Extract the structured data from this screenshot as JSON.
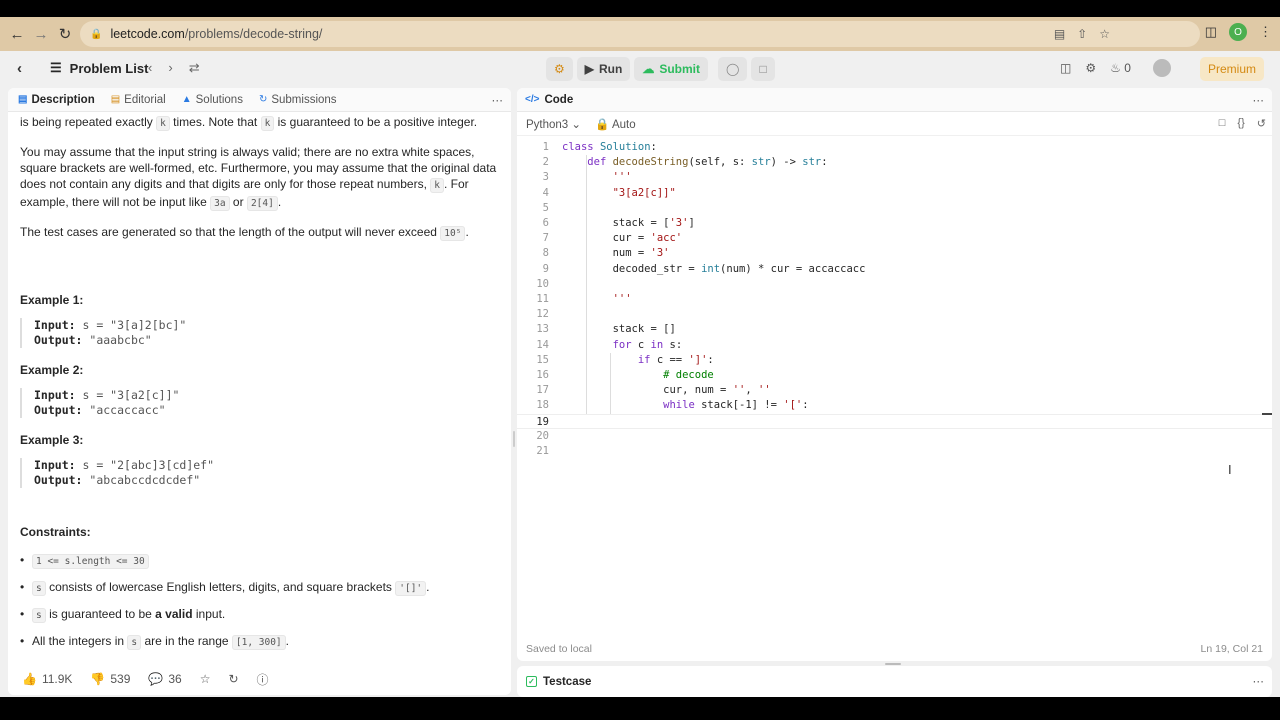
{
  "browser": {
    "url_host": "leetcode.com",
    "url_path": "/problems/decode-string/",
    "profile_initial": "O"
  },
  "header": {
    "problem_list": "Problem List",
    "run": "Run",
    "submit": "Submit",
    "streak_count": "0",
    "premium": "Premium"
  },
  "left_tabs": [
    "Description",
    "Editorial",
    "Solutions",
    "Submissions"
  ],
  "description": {
    "p0_a": "is being repeated exactly",
    "p0_k": "k",
    "p0_b": "times. Note that",
    "p0_k2": "k",
    "p0_c": "is guaranteed to be a positive integer.",
    "p1_a": "You may assume that the input string is always valid; there are no extra white spaces, square brackets are well-formed, etc. Furthermore, you may assume that the original data does not contain any digits and that digits are only for those repeat numbers,",
    "p1_k": "k",
    "p1_b": ". For example, there will not be input like",
    "p1_c1": "3a",
    "p1_or": "or",
    "p1_c2": "2[4]",
    "p2_a": "The test cases are generated so that the length of the output will never exceed",
    "p2_c": "10⁵",
    "examples": [
      {
        "title": "Example 1:",
        "input_label": "Input:",
        "input": "s = \"3[a]2[bc]\"",
        "output_label": "Output:",
        "output": "\"aaabcbc\""
      },
      {
        "title": "Example 2:",
        "input_label": "Input:",
        "input": "s = \"3[a2[c]]\"",
        "output_label": "Output:",
        "output": "\"accaccacc\""
      },
      {
        "title": "Example 3:",
        "input_label": "Input:",
        "input": "s = \"2[abc]3[cd]ef\"",
        "output_label": "Output:",
        "output": "\"abcabccdcdcdef\""
      }
    ],
    "constraints_title": "Constraints:",
    "c1_code": "1 <= s.length <= 30",
    "c2_code": "s",
    "c2_text": "consists of lowercase English letters, digits, and square brackets",
    "c2_code2": "'[]'",
    "c3_code": "s",
    "c3_text_a": "is guaranteed to be",
    "c3_bold": "a valid",
    "c3_text_b": "input.",
    "c4_text_a": "All the integers in",
    "c4_code": "s",
    "c4_text_b": "are in the range",
    "c4_code2": "[1, 300]"
  },
  "footer_left": {
    "likes": "11.9K",
    "dislikes": "539",
    "comments": "36"
  },
  "code_panel": {
    "tab": "Code",
    "language": "Python3",
    "mode": "Auto",
    "saved": "Saved to local",
    "position": "Ln 19, Col 21",
    "current_line": 19
  },
  "testcase": {
    "label": "Testcase"
  },
  "code_lines": [
    "class Solution:",
    "    def decodeString(self, s: str) -> str:",
    "        '''",
    "        \"3[a2[c]]\"",
    "",
    "        stack = ['3']",
    "        cur = 'acc'",
    "        num = '3'",
    "        decoded_str = int(num) * cur = accaccacc",
    "",
    "        '''",
    "",
    "        stack = []",
    "        for c in s:",
    "            if c == ']':",
    "                # decode",
    "                cur, num = '', ''",
    "                while stack[-1] != '[':",
    "",
    "",
    ""
  ]
}
